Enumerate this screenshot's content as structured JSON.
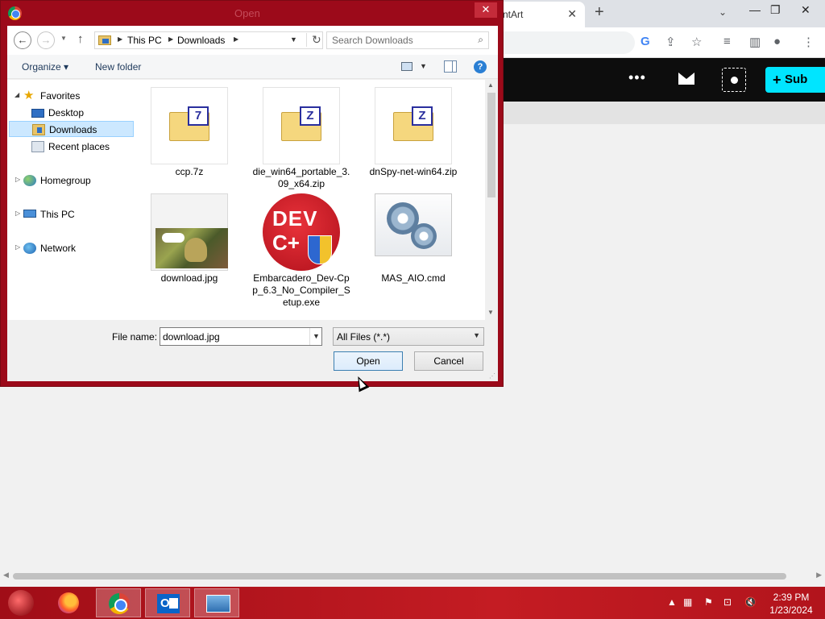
{
  "browser": {
    "tab_title": "ntArt",
    "tab_close_icon": "close-icon",
    "new_tab_icon": "plus-icon",
    "site": {
      "submit_label": "Sub",
      "accent_color": "#00e5ff"
    }
  },
  "dialog": {
    "title": "Open",
    "close_label": "✕",
    "breadcrumb": [
      "This PC",
      "Downloads"
    ],
    "search_placeholder": "Search Downloads",
    "organize_label": "Organize",
    "new_folder_label": "New folder",
    "help_label": "?",
    "nav": {
      "favorites": "Favorites",
      "desktop": "Desktop",
      "downloads": "Downloads",
      "recent": "Recent places",
      "homegroup": "Homegroup",
      "this_pc": "This PC",
      "network": "Network"
    },
    "files": [
      {
        "name": "ccp.7z",
        "badge": "7",
        "type": "archive-7z"
      },
      {
        "name": "die_win64_portable_3.09_x64.zip",
        "badge": "Z",
        "type": "archive-zip"
      },
      {
        "name": "dnSpy-net-win64.zip",
        "badge": "Z",
        "type": "archive-zip"
      },
      {
        "name": "download.jpg",
        "type": "image"
      },
      {
        "name": "Embarcadero_Dev-Cpp_6.3_No_Compiler_Setup.exe",
        "logo_line1": "DEV",
        "logo_line2": "C+",
        "type": "executable"
      },
      {
        "name": "MAS_AIO.cmd",
        "type": "script"
      }
    ],
    "file_name_label": "File name:",
    "file_name_value": "download.jpg",
    "file_type_value": "All Files (*.*)",
    "open_label": "Open",
    "cancel_label": "Cancel"
  },
  "taskbar": {
    "apps": [
      "Firefox",
      "Chrome",
      "Outlook",
      "Photos"
    ],
    "time": "2:39 PM",
    "date": "1/23/2024"
  }
}
